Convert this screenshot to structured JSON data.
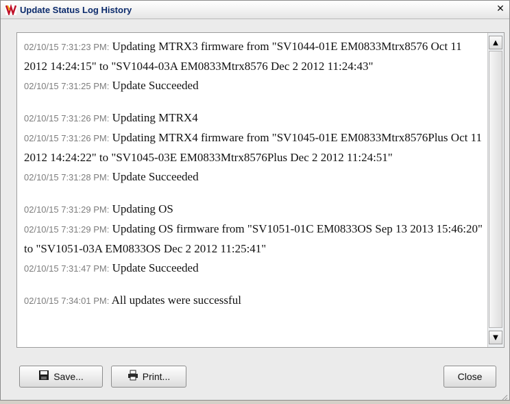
{
  "window": {
    "title": "Update Status Log History",
    "close_glyph": "✕"
  },
  "log": {
    "entries": [
      {
        "timestamp": "02/10/15 7:31:23 PM:",
        "message": "Updating MTRX3 firmware from \"SV1044-01E EM0833Mtrx8576 Oct 11 2012 14:24:15\" to \"SV1044-03A EM0833Mtrx8576 Dec 2 2012 11:24:43\""
      },
      {
        "timestamp": "02/10/15 7:31:25 PM:",
        "message": "Update Succeeded"
      },
      {
        "timestamp": "02/10/15 7:31:26 PM:",
        "message": "Updating MTRX4"
      },
      {
        "timestamp": "02/10/15 7:31:26 PM:",
        "message": "Updating MTRX4 firmware from \"SV1045-01E EM0833Mtrx8576Plus Oct 11 2012 14:24:22\" to \"SV1045-03E EM0833Mtrx8576Plus Dec 2 2012 11:24:51\""
      },
      {
        "timestamp": "02/10/15 7:31:28 PM:",
        "message": "Update Succeeded"
      },
      {
        "timestamp": "02/10/15 7:31:29 PM:",
        "message": "Updating OS"
      },
      {
        "timestamp": "02/10/15 7:31:29 PM:",
        "message": "Updating OS firmware from \"SV1051-01C EM0833OS Sep 13 2013 15:46:20\" to \"SV1051-03A EM0833OS Dec 2 2012 11:25:41\""
      },
      {
        "timestamp": "02/10/15 7:31:47 PM:",
        "message": "Update Succeeded"
      },
      {
        "timestamp": "02/10/15 7:34:01 PM:",
        "message": "All updates were successful"
      }
    ]
  },
  "buttons": {
    "save_label": "Save...",
    "print_label": "Print...",
    "close_label": "Close"
  },
  "icons": {
    "app": "app-logo-icon",
    "save": "floppy-disk-icon",
    "print": "printer-icon"
  },
  "colors": {
    "title_text": "#0b2a6b",
    "timestamp_text": "#7d7d7d"
  }
}
